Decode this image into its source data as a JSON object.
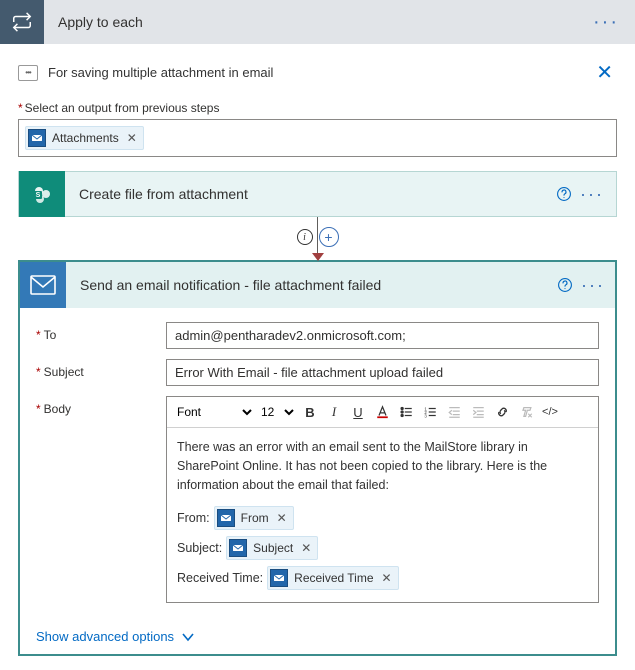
{
  "header": {
    "title": "Apply to each"
  },
  "note": {
    "text": "For saving multiple attachment in email"
  },
  "outputSection": {
    "label": "Select an output from previous steps",
    "token": "Attachments"
  },
  "createFileAction": {
    "title": "Create file from attachment"
  },
  "emailAction": {
    "title": "Send an email notification - file attachment failed",
    "fields": {
      "to_label": "To",
      "to_value": "admin@pentharadev2.onmicrosoft.com;",
      "subject_label": "Subject",
      "subject_value": "Error With Email - file attachment upload failed",
      "body_label": "Body"
    },
    "toolbar": {
      "font": "Font",
      "size": "12"
    },
    "bodyText": {
      "paragraph": "There was an error with an email sent to the MailStore library in SharePoint Online. It has not been copied to the library. Here is the information about the email that failed:",
      "from_label": "From:",
      "from_token": "From",
      "subject_label": "Subject:",
      "subject_token": "Subject",
      "received_label": "Received Time:",
      "received_token": "Received Time"
    },
    "advanced": "Show advanced options"
  }
}
